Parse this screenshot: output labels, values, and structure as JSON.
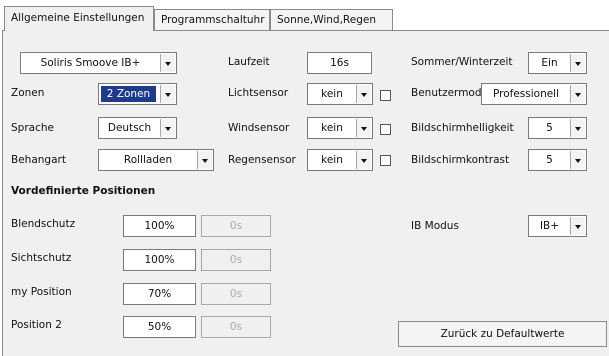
{
  "tabs": [
    {
      "label": "Allgemeine Einstellungen",
      "active": true
    },
    {
      "label": "Programmschaltuhr",
      "active": false
    },
    {
      "label": "Sonne,Wind,Regen",
      "active": false
    }
  ],
  "left": {
    "device": {
      "value": "Soliris Smoove IB+"
    },
    "zonen": {
      "label": "Zonen",
      "value": "2 Zonen"
    },
    "sprache": {
      "label": "Sprache",
      "value": "Deutsch"
    },
    "behangart": {
      "label": "Behangart",
      "value": "Rollladen"
    }
  },
  "middle": {
    "laufzeit": {
      "label": "Laufzeit",
      "value": "16s"
    },
    "lichtsensor": {
      "label": "Lichtsensor",
      "value": "kein"
    },
    "windsensor": {
      "label": "Windsensor",
      "value": "kein"
    },
    "regensensor": {
      "label": "Regensensor",
      "value": "kein"
    }
  },
  "right": {
    "sommer": {
      "label": "Sommer/Winterzeit",
      "value": "Ein"
    },
    "benutzermode": {
      "label": "Benutzermode",
      "value": "Professionell"
    },
    "helligkeit": {
      "label": "Bildschirmhelligkeit",
      "value": "5"
    },
    "kontrast": {
      "label": "Bildschirmkontrast",
      "value": "5"
    },
    "ibmodus": {
      "label": "IB Modus",
      "value": "IB+"
    }
  },
  "positions": {
    "heading": "Vordefinierte Positionen",
    "rows": [
      {
        "label": "Blendschutz",
        "percent": "100%",
        "time": "0s"
      },
      {
        "label": "Sichtschutz",
        "percent": "100%",
        "time": "0s"
      },
      {
        "label": "my Position",
        "percent": "70%",
        "time": "0s"
      },
      {
        "label": "Position 2",
        "percent": "50%",
        "time": "0s"
      }
    ]
  },
  "buttons": {
    "reset_label": "Zurück zu Defaultwerte"
  },
  "colors": {
    "selection_bg": "#1e3a8a",
    "panel_bg": "#f0f0f0"
  }
}
